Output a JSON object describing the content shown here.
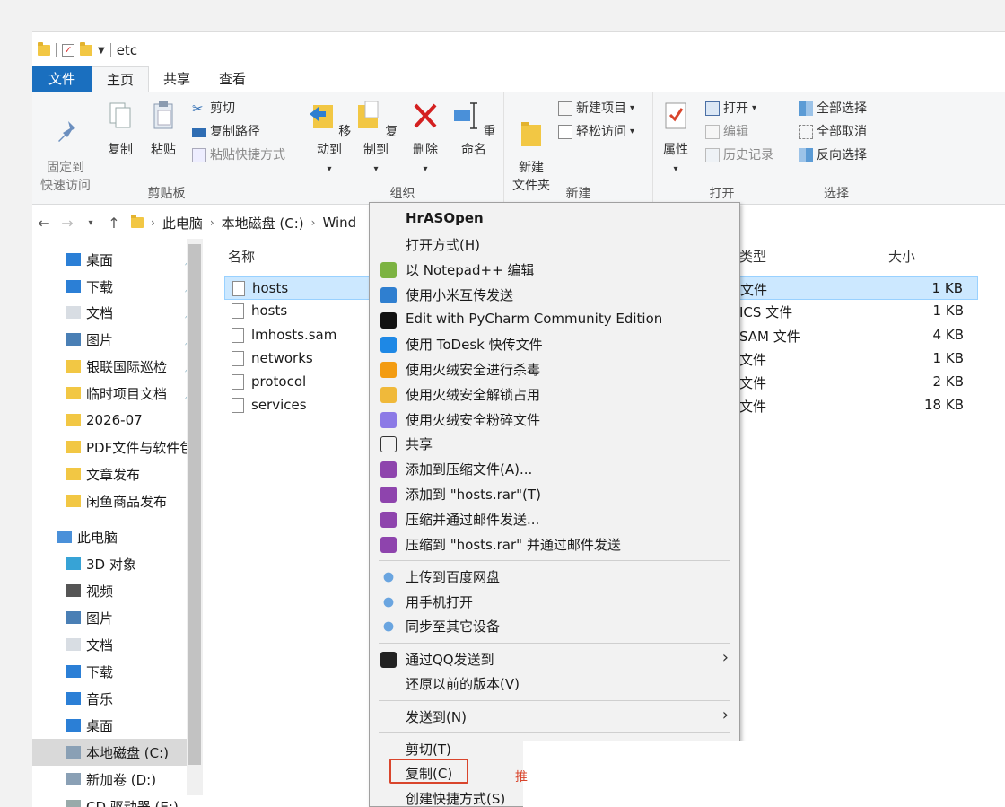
{
  "window": {
    "title_path": "etc"
  },
  "tabs": [
    {
      "label": "文件"
    },
    {
      "label": "主页"
    },
    {
      "label": "共享"
    },
    {
      "label": "查看"
    }
  ],
  "ribbon": {
    "clipboard": {
      "group_label": "剪贴板",
      "pin_label": "固定到\n快速访问",
      "copy_label": "复制",
      "paste_label": "粘贴",
      "cut_label": "剪切",
      "copy_path_label": "复制路径",
      "paste_shortcut_label": "粘贴快捷方式"
    },
    "organize": {
      "group_label": "组织",
      "move_label": "移动到",
      "copyto_label": "复制到",
      "delete_label": "删除",
      "rename_label": "重命名"
    },
    "new": {
      "group_label": "新建",
      "new_folder_label": "新建\n文件夹",
      "new_item_label": "新建项目",
      "easy_access_label": "轻松访问"
    },
    "open": {
      "group_label": "打开",
      "properties_label": "属性",
      "open_label": "打开",
      "edit_label": "编辑",
      "history_label": "历史记录"
    },
    "select": {
      "group_label": "选择",
      "select_all_label": "全部选择",
      "select_none_label": "全部取消",
      "invert_label": "反向选择"
    }
  },
  "address": {
    "crumbs": [
      "此电脑",
      "本地磁盘 (C:)",
      "Wind"
    ]
  },
  "nav": {
    "items": [
      {
        "label": "桌面",
        "icon": "desktop-icon",
        "pinned": true
      },
      {
        "label": "下载",
        "icon": "download-icon",
        "pinned": true
      },
      {
        "label": "文档",
        "icon": "document-icon",
        "pinned": true
      },
      {
        "label": "图片",
        "icon": "picture-icon",
        "pinned": true
      },
      {
        "label": "银联国际巡检",
        "icon": "folder-icon",
        "pinned": true
      },
      {
        "label": "临时项目文档",
        "icon": "folder-icon",
        "pinned": true
      },
      {
        "label": "2026-07",
        "icon": "folder-icon",
        "pinned": false
      },
      {
        "label": "PDF文件与软件包",
        "icon": "folder-icon",
        "pinned": false
      },
      {
        "label": "文章发布",
        "icon": "folder-icon",
        "pinned": false
      },
      {
        "label": "闲鱼商品发布",
        "icon": "folder-icon",
        "pinned": false
      },
      {
        "label": "此电脑",
        "icon": "computer-icon",
        "pinned": false
      },
      {
        "label": "3D 对象",
        "icon": "3d-objects-icon",
        "pinned": false
      },
      {
        "label": "视频",
        "icon": "video-icon",
        "pinned": false
      },
      {
        "label": "图片",
        "icon": "picture-icon",
        "pinned": false
      },
      {
        "label": "文档",
        "icon": "document-icon",
        "pinned": false
      },
      {
        "label": "下载",
        "icon": "download-icon",
        "pinned": false
      },
      {
        "label": "音乐",
        "icon": "music-icon",
        "pinned": false
      },
      {
        "label": "桌面",
        "icon": "desktop-icon",
        "pinned": false
      },
      {
        "label": "本地磁盘 (C:)",
        "icon": "drive-icon",
        "pinned": false,
        "selected": true
      },
      {
        "label": "新加卷 (D:)",
        "icon": "drive-icon",
        "pinned": false
      },
      {
        "label": "CD 驱动器 (E:)",
        "icon": "cd-drive-icon",
        "pinned": false
      }
    ]
  },
  "files": {
    "col_name": "名称",
    "col_type": "类型",
    "col_size": "大小",
    "rows": [
      {
        "name": "hosts",
        "type": "文件",
        "size": "1 KB",
        "selected": true
      },
      {
        "name": "hosts",
        "type": "ICS 文件",
        "size": "1 KB"
      },
      {
        "name": "lmhosts.sam",
        "type": "SAM 文件",
        "size": "4 KB"
      },
      {
        "name": "networks",
        "type": "文件",
        "size": "1 KB"
      },
      {
        "name": "protocol",
        "type": "文件",
        "size": "2 KB"
      },
      {
        "name": "services",
        "type": "文件",
        "size": "18 KB"
      }
    ]
  },
  "context_menu": {
    "items": [
      {
        "label": "HrASOpen",
        "icon": "",
        "bold": true
      },
      {
        "label": "打开方式(H)",
        "icon": ""
      },
      {
        "label": "以 Notepad++ 编辑",
        "icon": "notepadpp-icon"
      },
      {
        "label": "使用小米互传发送",
        "icon": "xiaomi-share-icon"
      },
      {
        "label": "Edit with PyCharm Community Edition",
        "icon": "pycharm-icon"
      },
      {
        "label": "使用 ToDesk 快传文件",
        "icon": "todesk-icon"
      },
      {
        "label": "使用火绒安全进行杀毒",
        "icon": "huorong-shield-icon"
      },
      {
        "label": "使用火绒安全解锁占用",
        "icon": "huorong-unlock-icon"
      },
      {
        "label": "使用火绒安全粉碎文件",
        "icon": "huorong-shred-icon"
      },
      {
        "label": "共享",
        "icon": "share-icon"
      },
      {
        "label": "添加到压缩文件(A)...",
        "icon": "winrar-icon"
      },
      {
        "label": "添加到 \"hosts.rar\"(T)",
        "icon": "winrar-icon"
      },
      {
        "label": "压缩并通过邮件发送...",
        "icon": "winrar-icon"
      },
      {
        "label": "压缩到 \"hosts.rar\" 并通过邮件发送",
        "icon": "winrar-icon"
      },
      {
        "label": "上传到百度网盘",
        "icon": "baidu-cloud-icon"
      },
      {
        "label": "用手机打开",
        "icon": "baidu-cloud-icon"
      },
      {
        "label": "同步至其它设备",
        "icon": "baidu-cloud-icon"
      },
      {
        "label": "通过QQ发送到",
        "icon": "qq-icon",
        "submenu": true
      },
      {
        "label": "还原以前的版本(V)",
        "icon": ""
      },
      {
        "label": "发送到(N)",
        "icon": "",
        "submenu": true
      },
      {
        "label": "剪切(T)",
        "icon": ""
      },
      {
        "label": "复制(C)",
        "icon": "",
        "highlighted": true
      },
      {
        "label": "创建快捷方式(S)",
        "icon": ""
      }
    ],
    "side_note": "推"
  },
  "colors": {
    "accent": "#1a6fbf",
    "highlight_border": "#d9452c",
    "selection": "#cce8ff"
  }
}
